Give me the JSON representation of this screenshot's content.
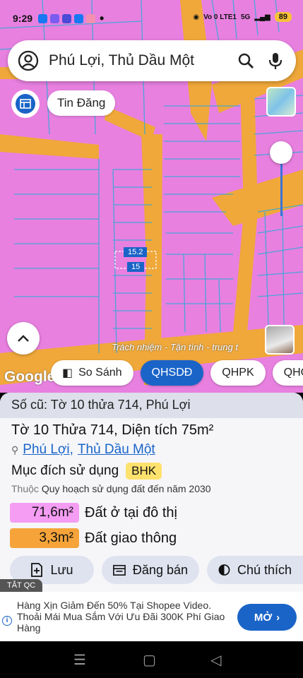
{
  "status_bar": {
    "time": "9:29",
    "signal_text": "Vo 0 LTE1",
    "network": "5G",
    "battery": "89"
  },
  "search": {
    "query": "Phú Lợi, Thủ Dầu Một"
  },
  "map": {
    "tin_dang_label": "Tin Đăng",
    "parcel_width": "15.2",
    "parcel_depth": "15",
    "watermark": "Trách nhiệm - Tận tình - trung t",
    "google_logo": "Google",
    "land_color": "#e880e0",
    "road_color": "#f0a83a"
  },
  "tabs": [
    {
      "label": "So Sánh",
      "icon": "compare-icon",
      "active": false
    },
    {
      "label": "QHSDĐ",
      "active": true
    },
    {
      "label": "QHPK",
      "active": false
    },
    {
      "label": "QHC",
      "active": false
    }
  ],
  "panel": {
    "old_number": "Số cũ: Tờ 10 thửa 714, Phú Lợi",
    "title": "Tờ 10 Thửa 714, Diện tích 75m²",
    "location_ward": "Phú Lợi",
    "location_sep": ",",
    "location_city": "Thủ Dầu Một",
    "purpose_label": "Mục đích sử dụng",
    "purpose_code": "BHK",
    "plan_prefix": "Thuộc",
    "plan_name": "Quy hoạch sử dụng đất đến năm 2030",
    "land_uses": [
      {
        "area": "71,6m²",
        "label": "Đất ở tại đô thị",
        "color": "#f49df3"
      },
      {
        "area": "3,3m²",
        "label": "Đất giao thông",
        "color": "#f6a43a"
      }
    ],
    "actions": {
      "save": "Lưu",
      "post": "Đăng bán",
      "note": "Chú thích"
    }
  },
  "ad": {
    "tag": "TẮT QC",
    "text": "Hàng Xịn Giảm Đến 50% Tại Shopee Video. Thoải Mái Mua Sắm Với Ưu Đãi 300K Phí Giao Hàng",
    "cta": "MỞ"
  }
}
